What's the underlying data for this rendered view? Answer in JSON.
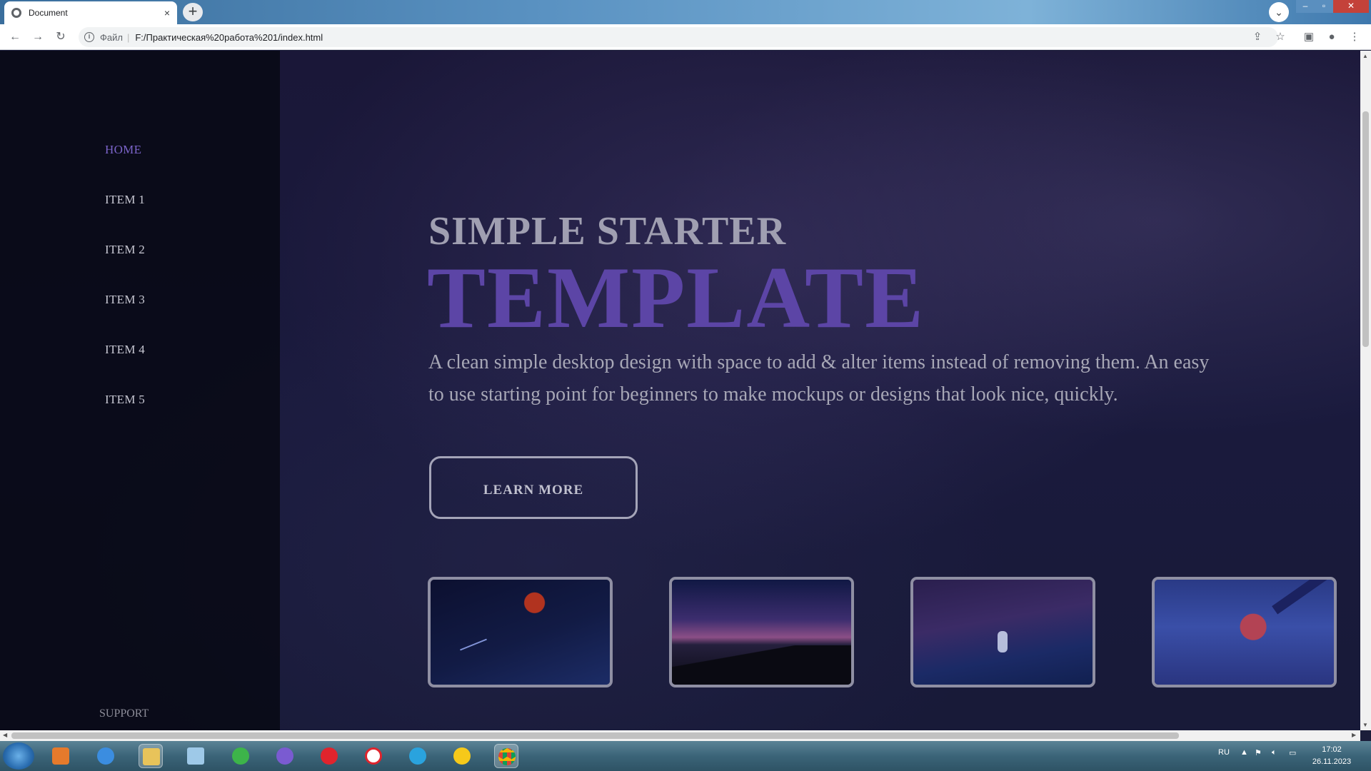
{
  "browser": {
    "tab_title": "Document",
    "tab_close": "×",
    "new_tab": "+",
    "tab_dropdown": "⌄",
    "window": {
      "minimize": "–",
      "maximize": "▫",
      "close": "✕"
    },
    "back": "←",
    "forward": "→",
    "reload": "↻",
    "info": "i",
    "address_scheme": "Файл",
    "address_sep": "|",
    "address_url": "F:/Практическая%20работа%201/index.html",
    "share": "⇪",
    "bookmark": "☆",
    "sidepanel": "▣",
    "profile": "●",
    "menu": "⋮"
  },
  "sidebar": {
    "items": [
      {
        "label": "HOME",
        "active": true
      },
      {
        "label": "ITEM 1",
        "active": false
      },
      {
        "label": "ITEM 2",
        "active": false
      },
      {
        "label": "ITEM 3",
        "active": false
      },
      {
        "label": "ITEM 4",
        "active": false
      },
      {
        "label": "ITEM 5",
        "active": false
      }
    ],
    "support": "SUPPORT"
  },
  "hero": {
    "kicker": "SIMPLE STARTER",
    "title": "TEMPLATE",
    "description": "A clean simple desktop design with space to add & alter items instead of removing them. An easy to use starting point for beginners to make mockups or designs that look nice, quickly.",
    "cta": "LEARN MORE"
  },
  "thumbnails": [
    {
      "name": "red-moon-night-sky"
    },
    {
      "name": "mountain-silhouette-sunset"
    },
    {
      "name": "person-in-snow-night"
    },
    {
      "name": "cyberpunk-character"
    }
  ],
  "taskbar": {
    "apps": [
      "start-button",
      "media-player-icon",
      "internet-explorer-icon",
      "file-explorer-icon",
      "notes-icon",
      "bird-app-icon",
      "viber-icon",
      "opera-icon",
      "yandex-browser-icon",
      "telegram-icon",
      "yandex-music-icon",
      "chrome-icon"
    ],
    "language": "RU",
    "time": "17:02",
    "date": "26.11.2023"
  },
  "colors": {
    "accent": "#5c45a6",
    "nav_active": "#7b64c9",
    "sidebar_bg": "#08090f",
    "page_bg": "#1a1738"
  }
}
